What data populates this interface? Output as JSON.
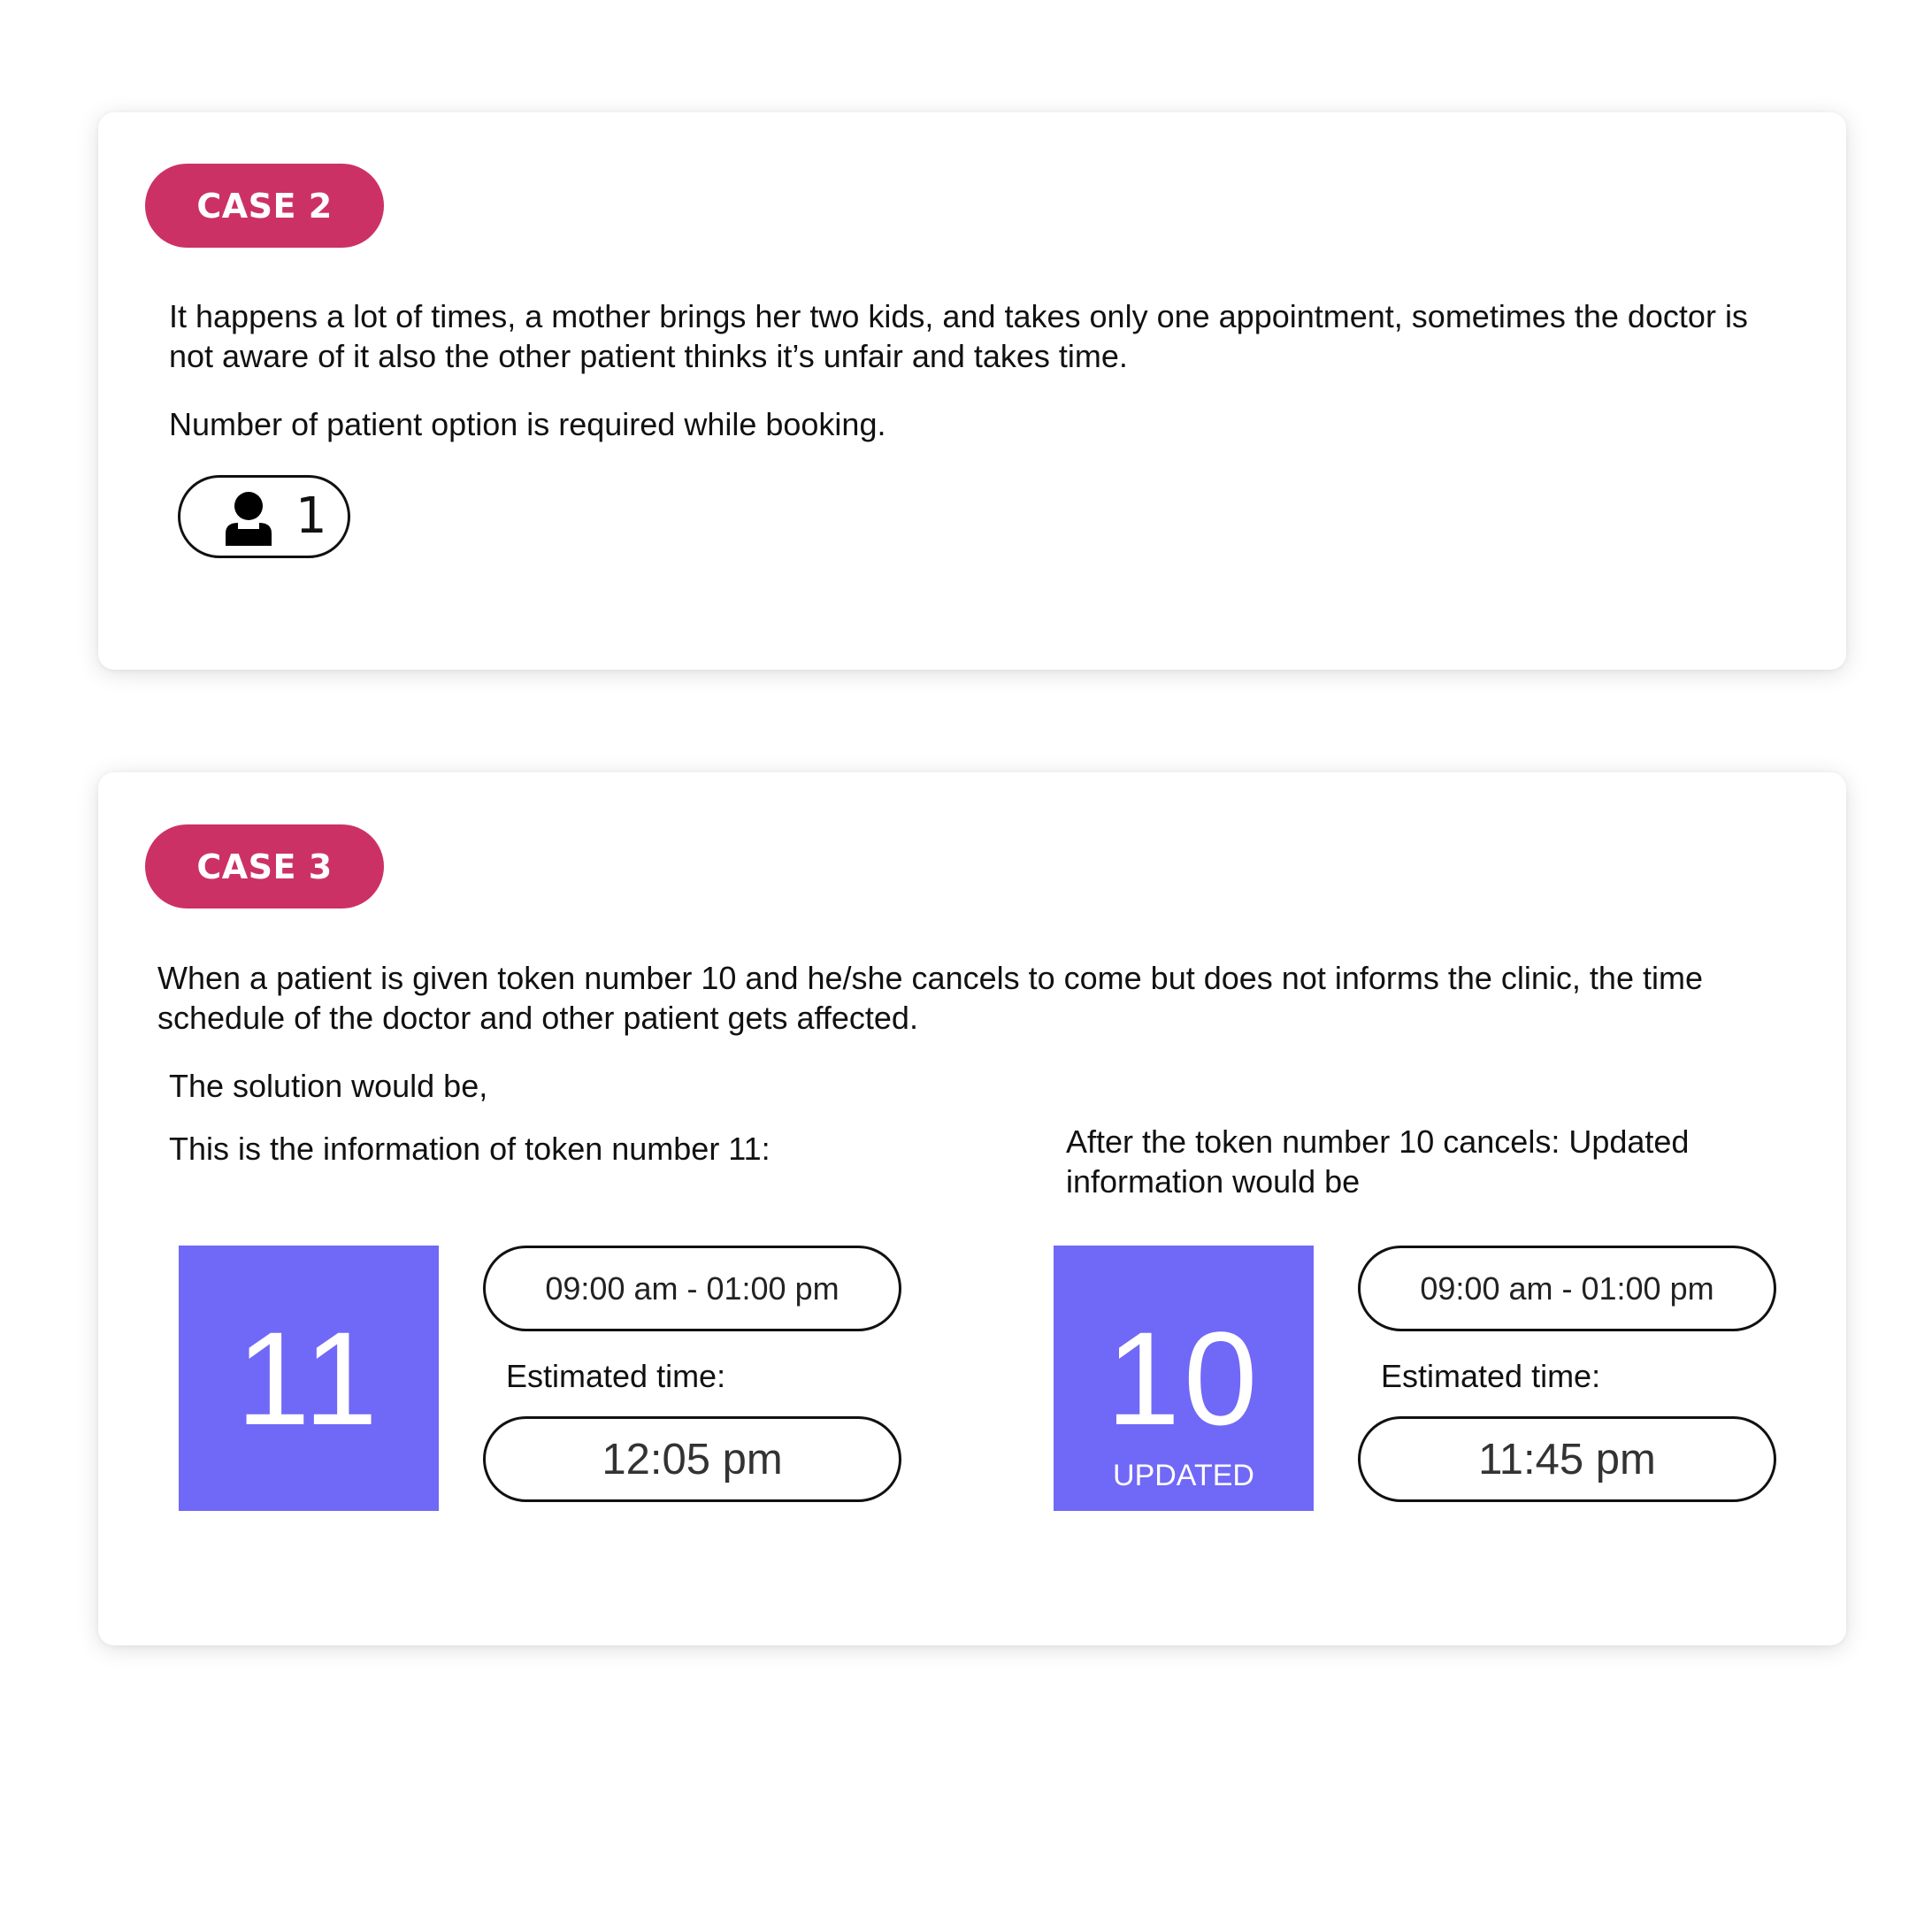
{
  "case2": {
    "badge": "CASE 2",
    "description": "It happens a lot of times, a mother brings her two kids, and takes only one appointment, sometimes the doctor is not aware of it also the other patient thinks it’s unfair and takes time.",
    "requirement": "Number of patient option is required while booking.",
    "patient_selector": {
      "icon": "person-icon",
      "count": "1"
    }
  },
  "case3": {
    "badge": "CASE 3",
    "description": "When a patient is given token number 10 and he/she cancels to come but does not informs the clinic, the time schedule of the doctor and other patient gets affected.",
    "solution_intro": "The solution would be,",
    "left": {
      "heading": "This is the information of token number 11:",
      "token_number": "11",
      "time_range": "09:00 am - 01:00 pm",
      "estimated_label": "Estimated time:",
      "estimated_time": "12:05 pm"
    },
    "right": {
      "heading": "After the token number 10 cancels: Updated information would be",
      "token_number": "10",
      "token_tag": "UPDATED",
      "time_range": "09:00 am - 01:00 pm",
      "estimated_label": "Estimated time:",
      "estimated_time": "11:45 pm"
    }
  },
  "colors": {
    "badge": "#cc3166",
    "token": "#7068f6"
  }
}
